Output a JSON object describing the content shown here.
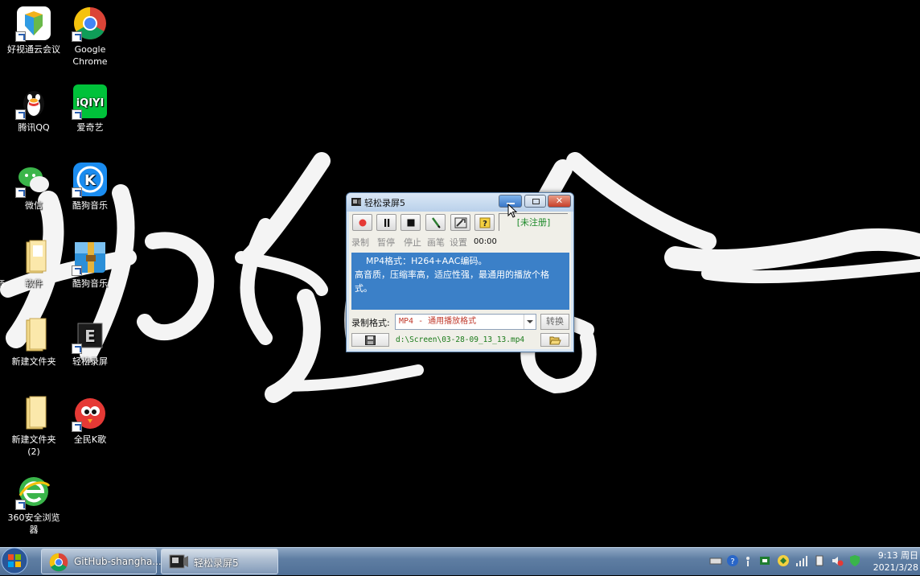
{
  "desktop": {
    "icons": [
      {
        "label": "好视通云会议",
        "icon": "fsmeeting-icon"
      },
      {
        "label": "Google Chrome",
        "icon": "chrome-icon"
      },
      {
        "label": "腾讯QQ",
        "icon": "qq-penguin-icon"
      },
      {
        "label": "爱奇艺",
        "icon": "iqiyi-icon"
      },
      {
        "label": "微信",
        "icon": "wechat-icon"
      },
      {
        "label": "酷狗音乐",
        "icon": "kugou-icon"
      },
      {
        "label": "软件",
        "icon": "folder-icon"
      },
      {
        "label": "酷狗音乐",
        "icon": "winrar-archive-icon"
      },
      {
        "label": "新建文件夹",
        "icon": "folder-icon"
      },
      {
        "label": "轻松录屏",
        "icon": "screen-recorder-icon"
      },
      {
        "label": "新建文件夹\n(2)",
        "icon": "folder-icon"
      },
      {
        "label": "全民K歌",
        "icon": "kge-bird-icon"
      },
      {
        "label": "360安全浏览\n器",
        "icon": "360-browser-icon"
      }
    ],
    "edge_fragment": "师"
  },
  "app": {
    "title": "轻松录屏5",
    "unregistered": "[未注册]",
    "toolbar": {
      "record": "录制",
      "pause": "暂停",
      "stop": "停止",
      "pen": "画笔",
      "settings": "设置"
    },
    "timer": "00:00",
    "info_line1": "MP4格式：H264+AAC编码。",
    "info_line2": "高音质，压缩率高，适应性强，最通用的播放个格式。",
    "format_label": "录制格式:",
    "format_value": "MP4 - 通用播放格式",
    "convert_label": "转换",
    "save_path": "d:\\Screen\\03-28-09_13_13.mp4"
  },
  "taskbar": {
    "tasks": [
      {
        "label": "GitHub-shangha...",
        "icon": "chrome-icon"
      },
      {
        "label": "轻松录屏5",
        "icon": "screen-recorder-icon"
      }
    ],
    "clock_time": "9:13 周日",
    "clock_date": "2021/3/28"
  },
  "colors": {
    "info_bg": "#3b80c8",
    "path_text": "#1a7a1a",
    "format_text": "#c0392b",
    "unregistered_text": "#1d8a2a"
  }
}
